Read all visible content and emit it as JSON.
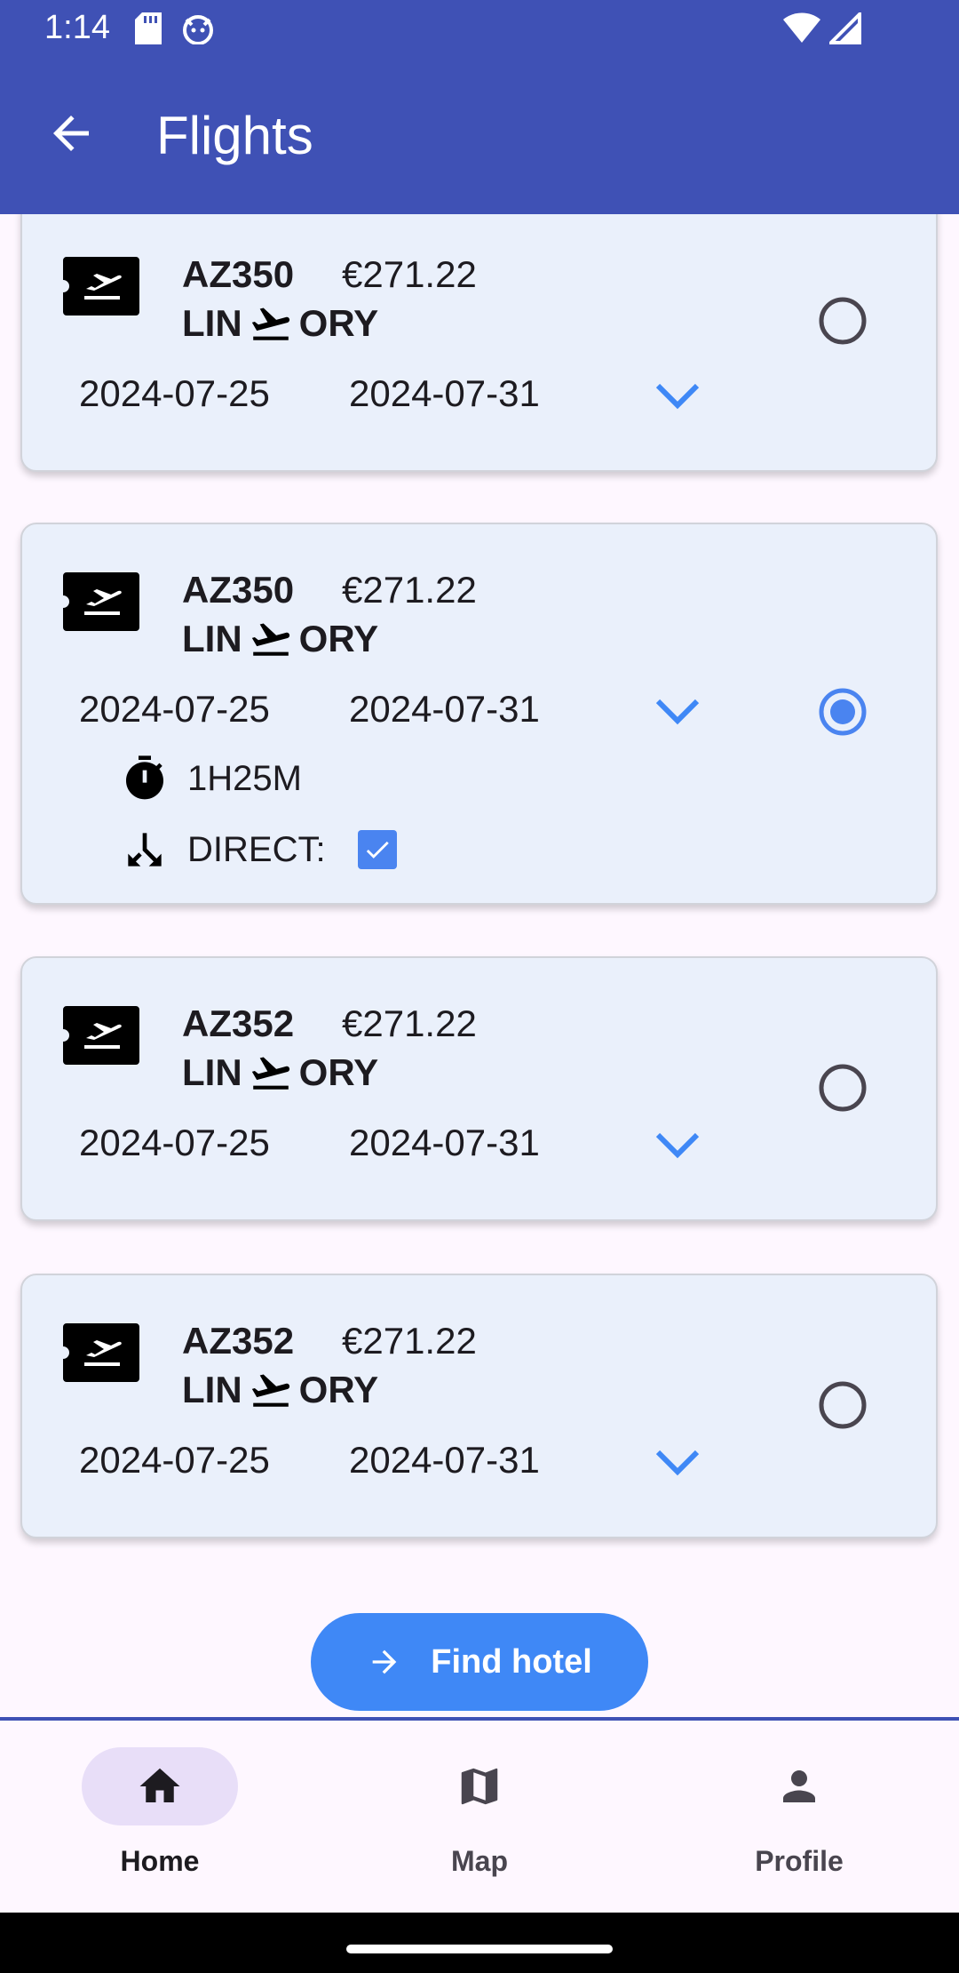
{
  "status_bar": {
    "time": "1:14"
  },
  "app_bar": {
    "title": "Flights"
  },
  "flights": [
    {
      "code": "AZ350",
      "price": "€271.22",
      "from": "LIN",
      "to": "ORY",
      "depart": "2024-07-25",
      "return": "2024-07-31",
      "selected": false,
      "expanded": false
    },
    {
      "code": "AZ350",
      "price": "€271.22",
      "from": "LIN",
      "to": "ORY",
      "depart": "2024-07-25",
      "return": "2024-07-31",
      "selected": true,
      "expanded": true,
      "duration": "1H25M",
      "direct_label": "DIRECT:",
      "direct": true
    },
    {
      "code": "AZ352",
      "price": "€271.22",
      "from": "LIN",
      "to": "ORY",
      "depart": "2024-07-25",
      "return": "2024-07-31",
      "selected": false,
      "expanded": false
    },
    {
      "code": "AZ352",
      "price": "€271.22",
      "from": "LIN",
      "to": "ORY",
      "depart": "2024-07-25",
      "return": "2024-07-31",
      "selected": false,
      "expanded": false
    }
  ],
  "find_hotel_label": "Find hotel",
  "nav": [
    {
      "label": "Home",
      "icon": "home-icon",
      "active": true
    },
    {
      "label": "Map",
      "icon": "map-icon",
      "active": false
    },
    {
      "label": "Profile",
      "icon": "person-icon",
      "active": false
    }
  ],
  "colors": {
    "app_bar": "#3F51B5",
    "card": "#EAF0FB",
    "accent": "#3F88F6",
    "radio_selected": "#4A84F0"
  }
}
